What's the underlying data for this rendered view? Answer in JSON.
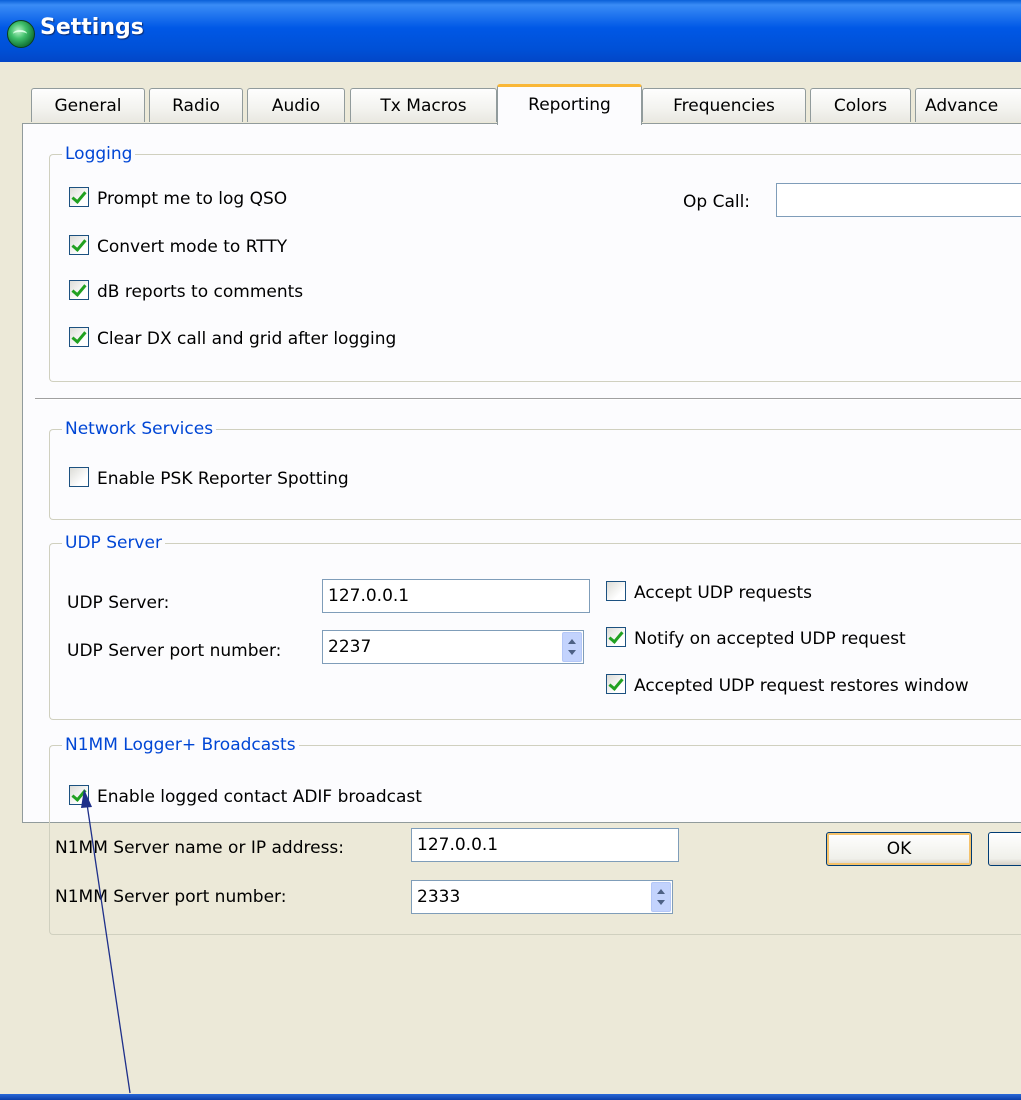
{
  "window": {
    "title": "Settings"
  },
  "tabs": [
    {
      "label": "General"
    },
    {
      "label": "Radio"
    },
    {
      "label": "Audio"
    },
    {
      "label": "Tx Macros"
    },
    {
      "label": "Reporting"
    },
    {
      "label": "Frequencies"
    },
    {
      "label": "Colors"
    },
    {
      "label": "Advance"
    }
  ],
  "active_tab": "Reporting",
  "logging": {
    "legend": "Logging",
    "prompt_log": {
      "label": "Prompt me to log QSO",
      "checked": true
    },
    "convert_mode": {
      "label": "Convert mode to RTTY",
      "checked": true
    },
    "db_reports": {
      "label": "dB reports to comments",
      "checked": true
    },
    "clear_dx": {
      "label": "Clear DX call and grid after logging",
      "checked": true
    },
    "op_call_label": "Op Call:",
    "op_call_value": ""
  },
  "network": {
    "legend": "Network Services",
    "psk_reporter": {
      "label": "Enable PSK Reporter Spotting",
      "checked": false
    }
  },
  "udp": {
    "legend": "UDP Server",
    "server_label": "UDP Server:",
    "server_value": "127.0.0.1",
    "port_label": "UDP Server port number:",
    "port_value": "2237",
    "accept": {
      "label": "Accept UDP requests",
      "checked": false
    },
    "notify": {
      "label": "Notify on accepted UDP request",
      "checked": true
    },
    "restore": {
      "label": "Accepted UDP request restores window",
      "checked": true
    }
  },
  "n1mm": {
    "legend": "N1MM Logger+  Broadcasts",
    "enable_adif": {
      "label": "Enable logged contact ADIF broadcast",
      "checked": true
    },
    "server_label": "N1MM Server name or IP address:",
    "server_value": "127.0.0.1",
    "port_label": "N1MM Server port number:",
    "port_value": "2333"
  },
  "buttons": {
    "ok": "OK",
    "cancel": ""
  }
}
